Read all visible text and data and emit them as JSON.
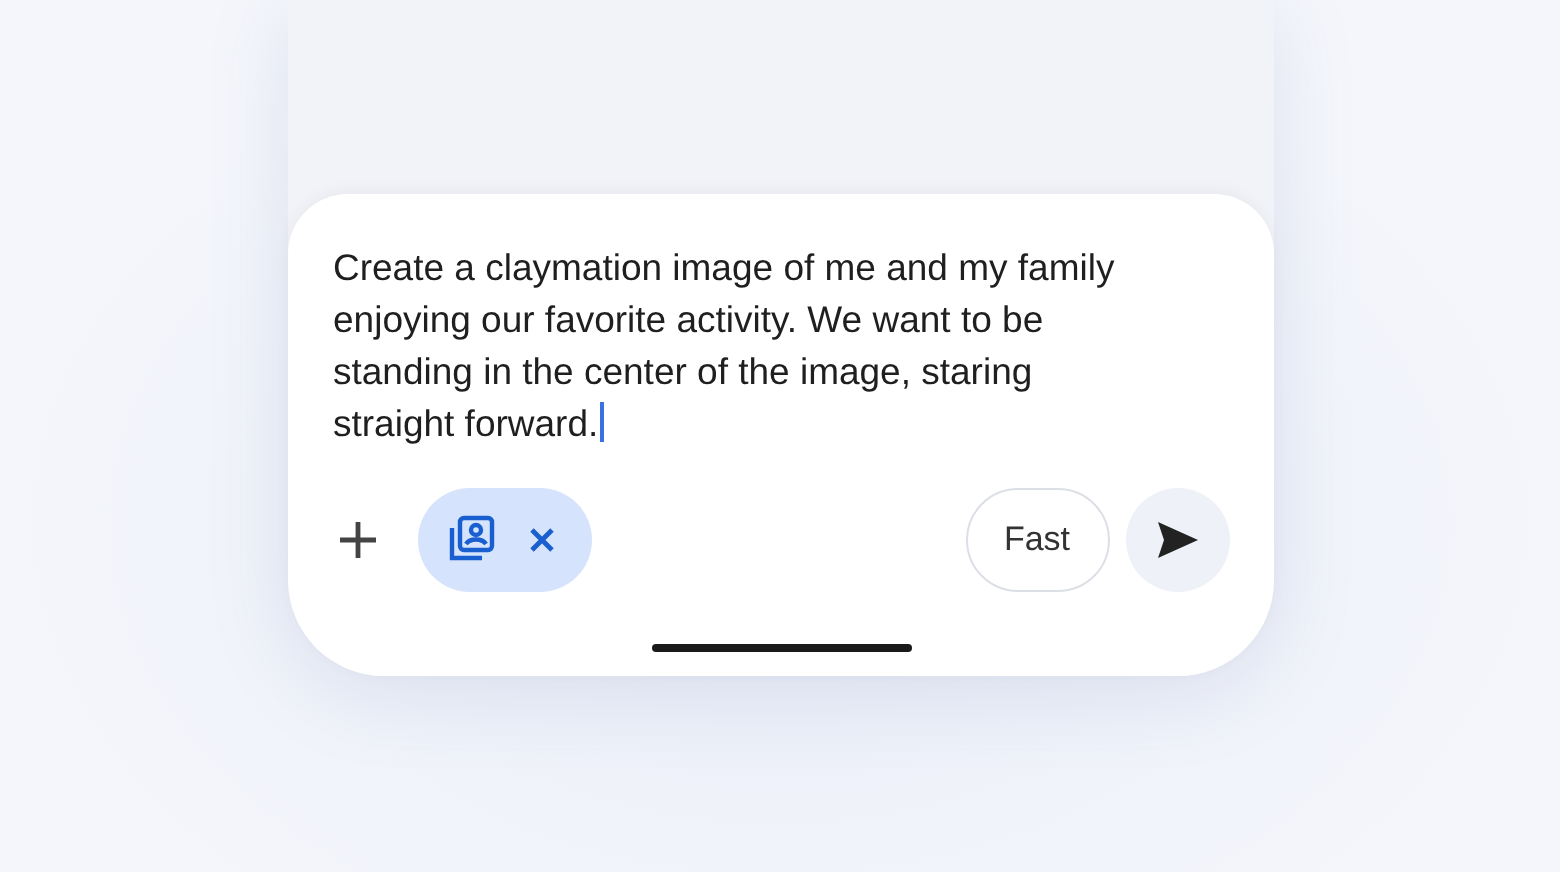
{
  "prompt": {
    "value": "Create a claymation image of me and my family enjoying our favorite activity. We want to be standing in the center of the image, staring straight forward."
  },
  "toolbar": {
    "mode_button": "Fast"
  }
}
